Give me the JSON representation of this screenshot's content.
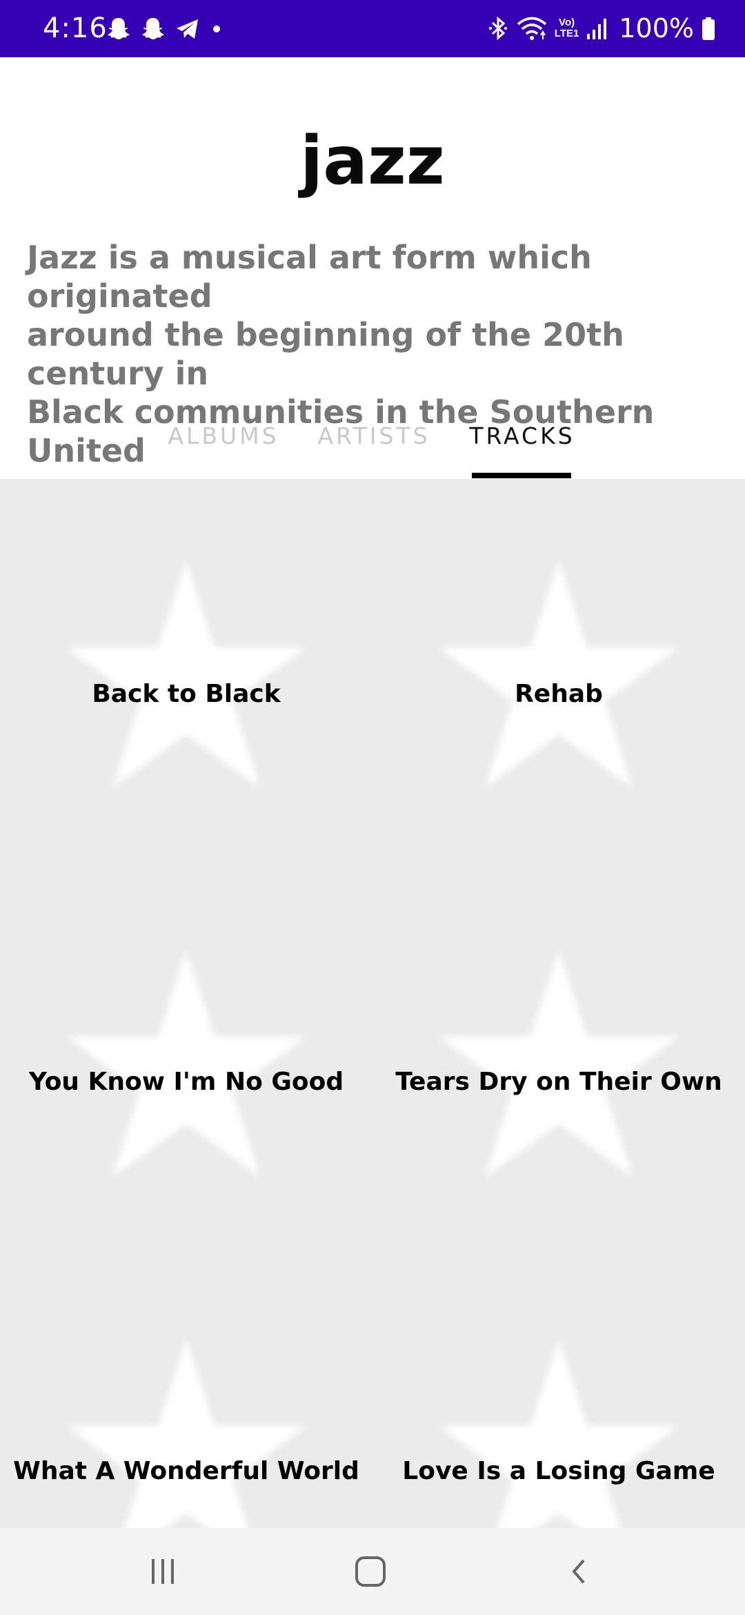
{
  "status_bar": {
    "time": "4:16",
    "left_icons": [
      "snapchat-icon",
      "snapchat-icon",
      "telegram-icon",
      "dot-icon"
    ],
    "right_icons": [
      "bluetooth-icon",
      "wifi-icon",
      "volte-icon",
      "signal-icon",
      "battery-icon"
    ],
    "volte_top": "Vo)",
    "volte_bottom": "LTE1",
    "battery": "100%"
  },
  "genre": {
    "title": "jazz",
    "description": "Jazz is a musical art form which originated\naround the beginning of the 20th century in\nBlack communities in the Southern United"
  },
  "tabs": [
    {
      "label": "ALBUMS",
      "active": false
    },
    {
      "label": "ARTISTS",
      "active": false
    },
    {
      "label": "TRACKS",
      "active": true
    }
  ],
  "tracks": [
    {
      "title": "Back to Black",
      "icon": "star-placeholder-icon"
    },
    {
      "title": "Rehab",
      "icon": "star-placeholder-icon"
    },
    {
      "title": "You Know I'm No Good",
      "icon": "star-placeholder-icon"
    },
    {
      "title": "Tears Dry on Their Own",
      "icon": "star-placeholder-icon"
    },
    {
      "title": "What A Wonderful World",
      "icon": "star-placeholder-icon"
    },
    {
      "title": "Love Is a Losing Game",
      "icon": "star-placeholder-icon"
    }
  ],
  "nav_bar": {
    "buttons": [
      "recents-icon",
      "home-icon",
      "back-icon"
    ]
  },
  "colors": {
    "status_bar": "#3800b3",
    "grid_background": "#ebebeb",
    "description_text": "#777777",
    "inactive_tab": "#c8c8c8",
    "active_tab": "#111111"
  }
}
